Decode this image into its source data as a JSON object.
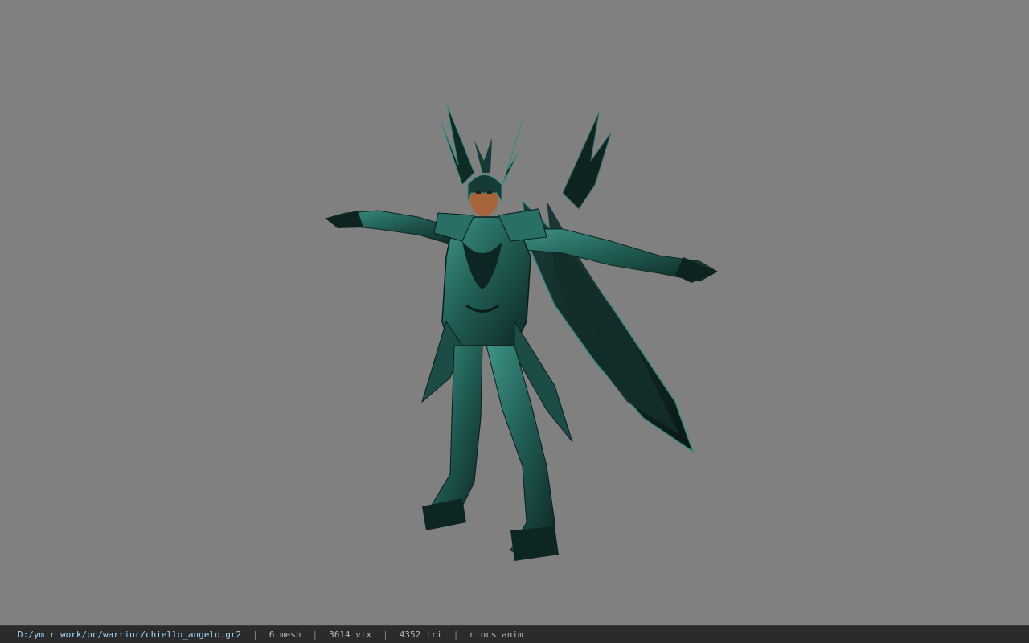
{
  "viewer": {
    "background_color": "#808080",
    "model": {
      "name": "warrior-armor-model",
      "armor_color": "#2f7a70",
      "armor_dark": "#102a26",
      "skin_color": "#a8643a"
    }
  },
  "status_bar": {
    "file_path": "D:/ymir work/pc/warrior/chiello_angelo.gr2",
    "separator": "|",
    "mesh_count": "6 mesh",
    "vertex_count": "3614 vtx",
    "triangle_count": "4352 tri",
    "anim_status": "nincs anim"
  }
}
